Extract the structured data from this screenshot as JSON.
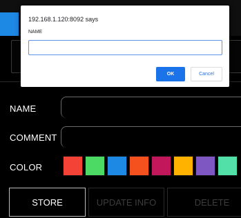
{
  "dialog": {
    "title": "192.168.1.120:8092 says",
    "message": "NAME",
    "input_value": "",
    "ok_label": "OK",
    "cancel_label": "Cancel"
  },
  "form": {
    "name_label": "NAME",
    "comment_label": "COMMENT",
    "color_label": "COLOR",
    "colors": [
      "#f44336",
      "#4cd964",
      "#1e88e5",
      "#f4511e",
      "#c2185b",
      "#ffb300",
      "#7e57c2",
      "#52e0a8"
    ]
  },
  "buttons": {
    "store": "STORE",
    "update": "UPDATE INFO",
    "delete": "DELETE"
  },
  "accents": {
    "primary_blue": "#1a73e8",
    "app_blue": "#1e88e5"
  }
}
